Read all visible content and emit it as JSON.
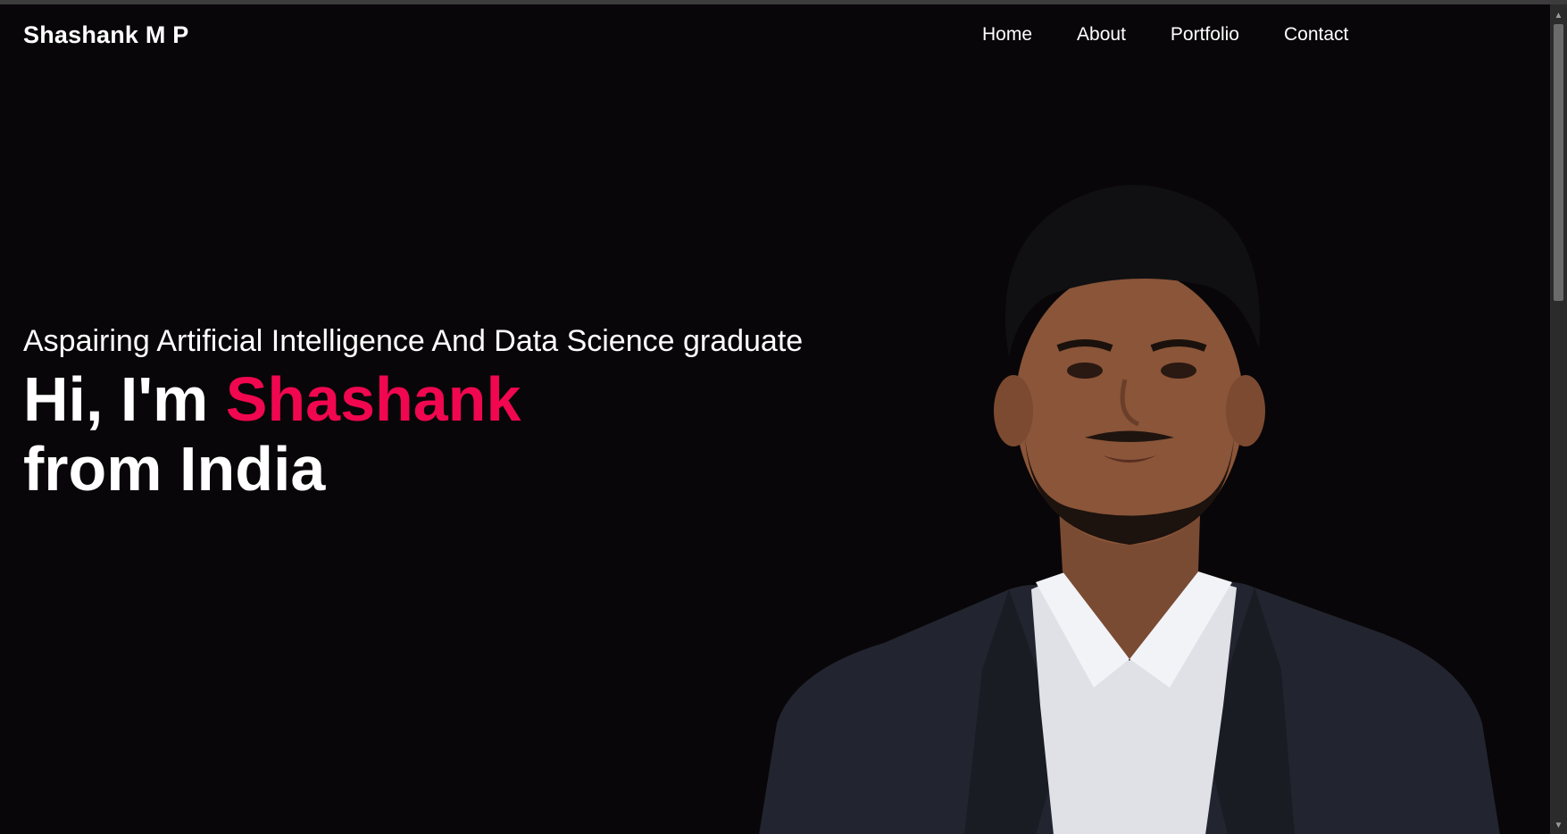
{
  "header": {
    "logo": "Shashank M P",
    "nav": [
      {
        "label": "Home"
      },
      {
        "label": "About"
      },
      {
        "label": "Portfolio"
      },
      {
        "label": "Contact"
      }
    ]
  },
  "hero": {
    "subtitle": "Aspairing Artificial Intelligence And Data Science graduate",
    "greeting": "Hi, I'm ",
    "name": "Shashank",
    "line2": "from India"
  },
  "colors": {
    "background": "#080608",
    "accent": "#f0074f",
    "text": "#ffffff"
  },
  "scrollbar": {
    "up_icon": "scroll-up-arrow",
    "down_icon": "scroll-down-arrow"
  }
}
